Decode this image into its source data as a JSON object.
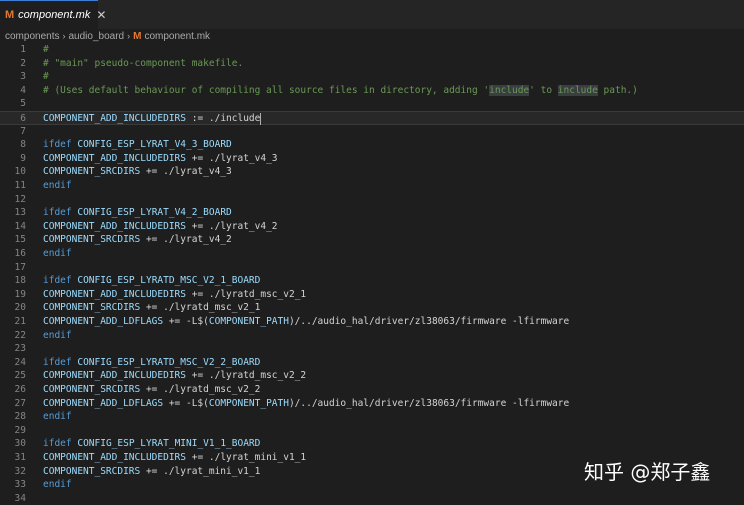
{
  "tab": {
    "icon": "M",
    "icon_name": "makefile-icon",
    "label": "component.mk",
    "close": "✕"
  },
  "breadcrumb": {
    "items": [
      "components",
      "audio_board",
      "component.mk"
    ],
    "separator": "›"
  },
  "editor": {
    "lines": [
      {
        "n": "1",
        "segs": [
          {
            "t": "#",
            "c": "comment"
          }
        ]
      },
      {
        "n": "2",
        "segs": [
          {
            "t": "# \"main\" pseudo-component makefile.",
            "c": "comment"
          }
        ]
      },
      {
        "n": "3",
        "segs": [
          {
            "t": "#",
            "c": "comment"
          }
        ]
      },
      {
        "n": "4",
        "segs": [
          {
            "t": "# (Uses default behaviour of compiling all source files in directory, adding '",
            "c": "comment"
          },
          {
            "t": "include",
            "c": "comment hl"
          },
          {
            "t": "' to ",
            "c": "comment"
          },
          {
            "t": "include",
            "c": "comment hl"
          },
          {
            "t": " path.)",
            "c": "comment"
          }
        ]
      },
      {
        "n": "5",
        "segs": []
      },
      {
        "n": "6",
        "current": true,
        "cursor": true,
        "segs": [
          {
            "t": "COMPONENT_ADD_INCLUDEDIRS",
            "c": "var"
          },
          {
            "t": " := ./include",
            "c": ""
          }
        ]
      },
      {
        "n": "7",
        "segs": []
      },
      {
        "n": "8",
        "segs": [
          {
            "t": "ifdef",
            "c": "kw"
          },
          {
            "t": " ",
            "c": ""
          },
          {
            "t": "CONFIG_ESP_LYRAT_V4_3_BOARD",
            "c": "var"
          }
        ]
      },
      {
        "n": "9",
        "segs": [
          {
            "t": "COMPONENT_ADD_INCLUDEDIRS",
            "c": "var"
          },
          {
            "t": " += ./lyrat_v4_3",
            "c": ""
          }
        ]
      },
      {
        "n": "10",
        "segs": [
          {
            "t": "COMPONENT_SRCDIRS",
            "c": "var"
          },
          {
            "t": " += ./lyrat_v4_3",
            "c": ""
          }
        ]
      },
      {
        "n": "11",
        "segs": [
          {
            "t": "endif",
            "c": "kw"
          }
        ]
      },
      {
        "n": "12",
        "segs": []
      },
      {
        "n": "13",
        "segs": [
          {
            "t": "ifdef",
            "c": "kw"
          },
          {
            "t": " ",
            "c": ""
          },
          {
            "t": "CONFIG_ESP_LYRAT_V4_2_BOARD",
            "c": "var"
          }
        ]
      },
      {
        "n": "14",
        "segs": [
          {
            "t": "COMPONENT_ADD_INCLUDEDIRS",
            "c": "var"
          },
          {
            "t": " += ./lyrat_v4_2",
            "c": ""
          }
        ]
      },
      {
        "n": "15",
        "segs": [
          {
            "t": "COMPONENT_SRCDIRS",
            "c": "var"
          },
          {
            "t": " += ./lyrat_v4_2",
            "c": ""
          }
        ]
      },
      {
        "n": "16",
        "segs": [
          {
            "t": "endif",
            "c": "kw"
          }
        ]
      },
      {
        "n": "17",
        "segs": []
      },
      {
        "n": "18",
        "segs": [
          {
            "t": "ifdef",
            "c": "kw"
          },
          {
            "t": " ",
            "c": ""
          },
          {
            "t": "CONFIG_ESP_LYRATD_MSC_V2_1_BOARD",
            "c": "var"
          }
        ]
      },
      {
        "n": "19",
        "segs": [
          {
            "t": "COMPONENT_ADD_INCLUDEDIRS",
            "c": "var"
          },
          {
            "t": " += ./lyratd_msc_v2_1",
            "c": ""
          }
        ]
      },
      {
        "n": "20",
        "segs": [
          {
            "t": "COMPONENT_SRCDIRS",
            "c": "var"
          },
          {
            "t": " += ./lyratd_msc_v2_1",
            "c": ""
          }
        ]
      },
      {
        "n": "21",
        "segs": [
          {
            "t": "COMPONENT_ADD_LDFLAGS",
            "c": "var"
          },
          {
            "t": " += -L$(",
            "c": ""
          },
          {
            "t": "COMPONENT_PATH",
            "c": "var"
          },
          {
            "t": ")/../audio_hal/driver/zl38063/firmware -lfirmware",
            "c": ""
          }
        ]
      },
      {
        "n": "22",
        "segs": [
          {
            "t": "endif",
            "c": "kw"
          }
        ]
      },
      {
        "n": "23",
        "segs": []
      },
      {
        "n": "24",
        "segs": [
          {
            "t": "ifdef",
            "c": "kw"
          },
          {
            "t": " ",
            "c": ""
          },
          {
            "t": "CONFIG_ESP_LYRATD_MSC_V2_2_BOARD",
            "c": "var"
          }
        ]
      },
      {
        "n": "25",
        "segs": [
          {
            "t": "COMPONENT_ADD_INCLUDEDIRS",
            "c": "var"
          },
          {
            "t": " += ./lyratd_msc_v2_2",
            "c": ""
          }
        ]
      },
      {
        "n": "26",
        "segs": [
          {
            "t": "COMPONENT_SRCDIRS",
            "c": "var"
          },
          {
            "t": " += ./lyratd_msc_v2_2",
            "c": ""
          }
        ]
      },
      {
        "n": "27",
        "segs": [
          {
            "t": "COMPONENT_ADD_LDFLAGS",
            "c": "var"
          },
          {
            "t": " += -L$(",
            "c": ""
          },
          {
            "t": "COMPONENT_PATH",
            "c": "var"
          },
          {
            "t": ")/../audio_hal/driver/zl38063/firmware -lfirmware",
            "c": ""
          }
        ]
      },
      {
        "n": "28",
        "segs": [
          {
            "t": "endif",
            "c": "kw"
          }
        ]
      },
      {
        "n": "29",
        "segs": []
      },
      {
        "n": "30",
        "segs": [
          {
            "t": "ifdef",
            "c": "kw"
          },
          {
            "t": " ",
            "c": ""
          },
          {
            "t": "CONFIG_ESP_LYRAT_MINI_V1_1_BOARD",
            "c": "var"
          }
        ]
      },
      {
        "n": "31",
        "segs": [
          {
            "t": "COMPONENT_ADD_INCLUDEDIRS",
            "c": "var"
          },
          {
            "t": " += ./lyrat_mini_v1_1",
            "c": ""
          }
        ]
      },
      {
        "n": "32",
        "segs": [
          {
            "t": "COMPONENT_SRCDIRS",
            "c": "var"
          },
          {
            "t": " += ./lyrat_mini_v1_1",
            "c": ""
          }
        ]
      },
      {
        "n": "33",
        "segs": [
          {
            "t": "endif",
            "c": "kw"
          }
        ]
      },
      {
        "n": "34",
        "segs": []
      }
    ]
  },
  "watermark": "知乎 @郑子鑫",
  "colors": {
    "background": "#1e1e1e",
    "comment": "#6a9955",
    "keyword": "#569cd6",
    "variable": "#9cdcfe",
    "text": "#d4d4d4",
    "line_number": "#858585",
    "makefile_icon": "#e37933"
  }
}
